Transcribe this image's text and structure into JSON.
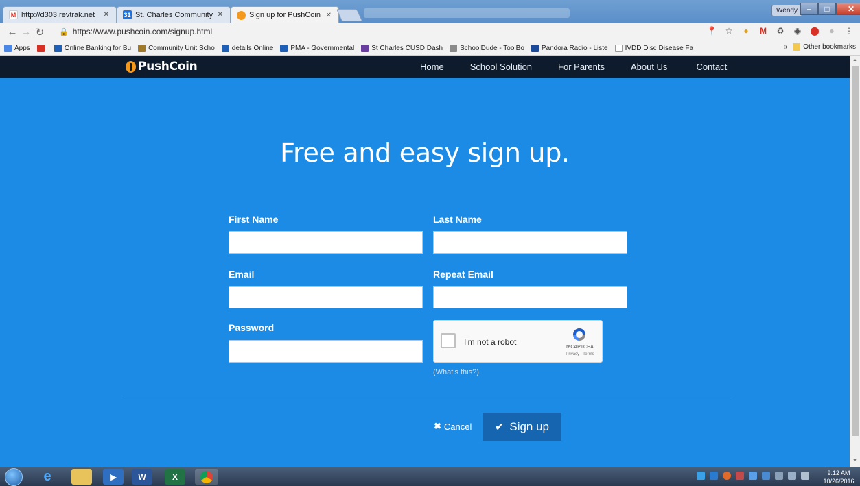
{
  "browser": {
    "tabs": [
      {
        "title": "http://d303.revtrak.net",
        "icon": "gmail-icon",
        "icon_color": "#d93025",
        "active": false
      },
      {
        "title": "St. Charles Community U",
        "icon": "calendar-icon",
        "icon_color": "#1a73e8",
        "active": false
      },
      {
        "title": "Sign up for PushCoin",
        "icon": "pushcoin-icon",
        "icon_color": "#f39a1e",
        "active": true
      }
    ],
    "window_user": "Wendy",
    "url": "https://www.pushcoin.com/signup.html",
    "bookmarks": [
      {
        "label": "Apps",
        "color": "#4a88e8"
      },
      {
        "label": "",
        "color": "#d93025"
      },
      {
        "label": "Online Banking for Bu",
        "color": "#1e5fb8"
      },
      {
        "label": "Community Unit Scho",
        "color": "#a07a2a"
      },
      {
        "label": "details Online",
        "color": "#1e5fb8"
      },
      {
        "label": "PMA - Governmental",
        "color": "#1e5fb8"
      },
      {
        "label": "St Charles CUSD Dash",
        "color": "#6a3da0"
      },
      {
        "label": "SchoolDude - ToolBo",
        "color": "#8a8a8a"
      },
      {
        "label": "Pandora Radio - Liste",
        "color": "#1c4a9a"
      },
      {
        "label": "IVDD Disc Disease Fa",
        "color": "#9a9a9a"
      }
    ],
    "bookmarks_overflow": "»",
    "other_bookmarks": "Other bookmarks"
  },
  "site": {
    "logo": "PushCoin",
    "nav": [
      "Home",
      "School Solution",
      "For Parents",
      "About Us",
      "Contact"
    ],
    "headline": "Free and easy sign up.",
    "form": {
      "first_name_label": "First Name",
      "last_name_label": "Last Name",
      "email_label": "Email",
      "repeat_email_label": "Repeat Email",
      "password_label": "Password",
      "first_name_value": "",
      "last_name_value": "",
      "email_value": "",
      "repeat_email_value": "",
      "password_value": ""
    },
    "recaptcha": {
      "label": "I'm not a robot",
      "brand": "reCAPTCHA",
      "terms": "Privacy - Terms",
      "whats_this": "(What's this?)"
    },
    "cancel_label": "Cancel",
    "signup_label": "Sign up"
  },
  "taskbar": {
    "time": "9:12 AM",
    "date": "10/26/2016"
  },
  "colors": {
    "page_bg": "#1c8be6",
    "nav_bg": "#0d1b2c",
    "signup_button": "#1565b0",
    "logo_accent": "#f39a1e"
  }
}
